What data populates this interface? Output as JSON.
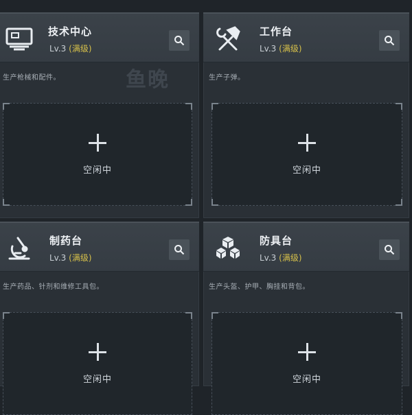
{
  "watermark": "鱼晚",
  "cards": [
    {
      "title": "技术中心",
      "level": "Lv.3",
      "max": "(满级)",
      "desc": "生产枪械和配件。",
      "slot_label": "空闲中",
      "icon": "monitor-icon"
    },
    {
      "title": "工作台",
      "level": "Lv.3",
      "max": "(满级)",
      "desc": "生产子弹。",
      "slot_label": "空闲中",
      "icon": "hammer-wrench-icon"
    },
    {
      "title": "制药台",
      "level": "Lv.3",
      "max": "(满级)",
      "desc": "生产药品、针剂和维修工具包。",
      "slot_label": "空闲中",
      "icon": "microscope-icon"
    },
    {
      "title": "防具台",
      "level": "Lv.3",
      "max": "(满级)",
      "desc": "生产头盔、护甲、胸挂和背包。",
      "slot_label": "空闲中",
      "icon": "cubes-icon"
    }
  ],
  "colors": {
    "background": "#1f2429",
    "card": "#2a3036",
    "header": "#3b4249",
    "max_level": "#d6c04a"
  }
}
